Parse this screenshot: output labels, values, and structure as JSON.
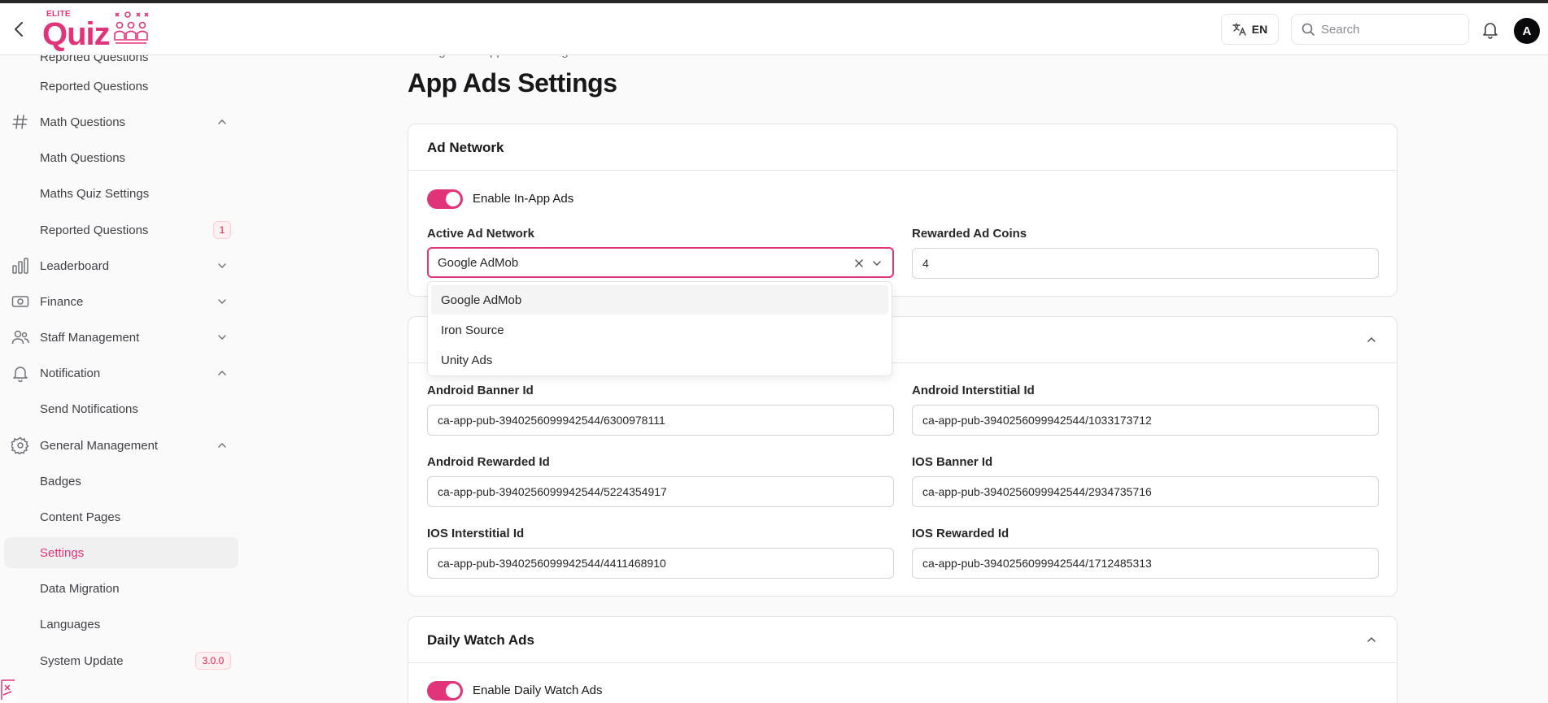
{
  "header": {
    "logo_small": "ELITE",
    "logo_text": "Quiz",
    "lang_label": "EN",
    "search_placeholder": "Search",
    "avatar_initial": "A"
  },
  "sidebar": {
    "cut_item": "Reported Questions",
    "items": [
      {
        "label": "Reported Questions"
      },
      {
        "label": "Math Questions"
      },
      {
        "label": "Math Questions"
      },
      {
        "label": "Maths Quiz Settings"
      },
      {
        "label": "Reported Questions",
        "badge": "1"
      },
      {
        "label": "Leaderboard"
      },
      {
        "label": "Finance"
      },
      {
        "label": "Staff Management"
      },
      {
        "label": "Notification"
      },
      {
        "label": "Send Notifications"
      },
      {
        "label": "General Management"
      },
      {
        "label": "Badges"
      },
      {
        "label": "Content Pages"
      },
      {
        "label": "Settings"
      },
      {
        "label": "Data Migration"
      },
      {
        "label": "Languages"
      },
      {
        "label": "System Update",
        "badge": "3.0.0"
      }
    ]
  },
  "breadcrumb": [
    "Settings",
    ">",
    "App Ads Settings"
  ],
  "page_title": "App Ads Settings",
  "ad_network": {
    "title": "Ad Network",
    "toggle_label": "Enable In-App Ads",
    "active_label": "Active Ad Network",
    "active_value": "Google AdMob",
    "coins_label": "Rewarded Ad Coins",
    "coins_value": "4",
    "options": [
      "Google AdMob",
      "Iron Source",
      "Unity Ads"
    ]
  },
  "ids": {
    "android_banner_label": "Android Banner Id",
    "android_banner_value": "ca-app-pub-3940256099942544/6300978111",
    "android_interstitial_label": "Android Interstitial Id",
    "android_interstitial_value": "ca-app-pub-3940256099942544/1033173712",
    "android_rewarded_label": "Android Rewarded Id",
    "android_rewarded_value": "ca-app-pub-3940256099942544/5224354917",
    "ios_banner_label": "IOS Banner Id",
    "ios_banner_value": "ca-app-pub-3940256099942544/2934735716",
    "ios_interstitial_label": "IOS Interstitial Id",
    "ios_interstitial_value": "ca-app-pub-3940256099942544/4411468910",
    "ios_rewarded_label": "IOS Rewarded Id",
    "ios_rewarded_value": "ca-app-pub-3940256099942544/1712485313"
  },
  "daily": {
    "title": "Daily Watch Ads",
    "toggle_label": "Enable Daily Watch Ads"
  },
  "colors": {
    "accent": "#e0337a",
    "border": "#e4e4e7"
  },
  "icons": [
    "back-arrow-icon",
    "translate-icon",
    "search-icon",
    "bell-icon",
    "hash-icon",
    "bar-chart-icon",
    "money-icon",
    "users-icon",
    "bell-outline-icon",
    "gear-icon",
    "chevron-down-icon",
    "chevron-up-icon",
    "close-icon"
  ]
}
